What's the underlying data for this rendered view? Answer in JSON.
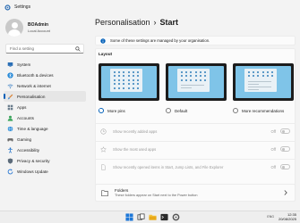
{
  "window": {
    "title": "Settings",
    "accent": "#005fb8"
  },
  "profile": {
    "name": "BOAdmin",
    "subtitle": "Local Account"
  },
  "search": {
    "placeholder": "Find a setting"
  },
  "sidebar": {
    "items": [
      {
        "label": "System",
        "icon": "monitor-icon",
        "color": "#2b6fb6"
      },
      {
        "label": "Bluetooth & devices",
        "icon": "bluetooth-icon",
        "color": "#2a8bd8"
      },
      {
        "label": "Network & internet",
        "icon": "wifi-icon",
        "color": "#3b7fc4"
      },
      {
        "label": "Personalisation",
        "icon": "brush-icon",
        "color": "#d87c2a",
        "active": true
      },
      {
        "label": "Apps",
        "icon": "apps-icon",
        "color": "#6b7d8d"
      },
      {
        "label": "Accounts",
        "icon": "person-icon",
        "color": "#3ba55c"
      },
      {
        "label": "Time & language",
        "icon": "globe-icon",
        "color": "#2a8bd8"
      },
      {
        "label": "Gaming",
        "icon": "controller-icon",
        "color": "#6b6b6b"
      },
      {
        "label": "Accessibility",
        "icon": "accessibility-icon",
        "color": "#1e6fc7"
      },
      {
        "label": "Privacy & security",
        "icon": "shield-icon",
        "color": "#5c6b7a"
      },
      {
        "label": "Windows Update",
        "icon": "update-icon",
        "color": "#1d6fd0"
      }
    ]
  },
  "breadcrumb": {
    "parent": "Personalisation",
    "separator": "›",
    "current": "Start"
  },
  "banner": {
    "text": "Some of these settings are managed by your organisation.",
    "icon": "info-icon"
  },
  "layout": {
    "title": "Layout",
    "options": [
      {
        "label": "More pins",
        "selected": true
      },
      {
        "label": "Default",
        "selected": false
      },
      {
        "label": "More recommendations",
        "selected": false
      }
    ]
  },
  "settings": [
    {
      "label": "Show recently added apps",
      "state": "Off",
      "icon": "clock-icon"
    },
    {
      "label": "Show the most used apps",
      "state": "Off",
      "icon": "star-icon"
    },
    {
      "label": "Show recently opened items in Start, Jump Lists, and File Explorer",
      "state": "Off",
      "icon": "file-icon"
    }
  ],
  "folders": {
    "title": "Folders",
    "subtitle": "These folders appear on Start next to the Power button"
  },
  "taskbar": {
    "time": "12:35",
    "date": "20/08/2025",
    "tray_label": "ENG"
  }
}
